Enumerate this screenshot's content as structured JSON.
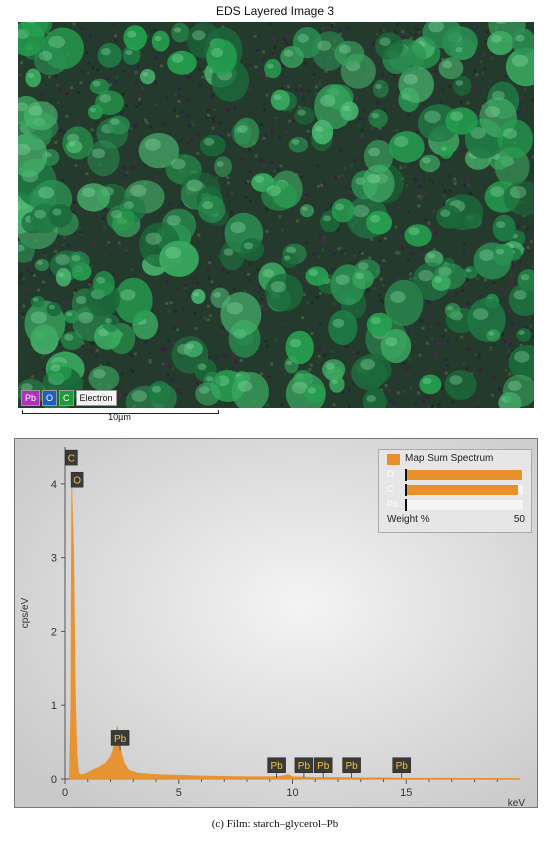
{
  "map": {
    "title": "EDS Layered Image 3",
    "channels": [
      "Pb",
      "O",
      "C",
      "Electron"
    ],
    "scale_label": "10µm"
  },
  "chart_data": {
    "type": "area",
    "xlabel": "keV",
    "ylabel": "cps/eV",
    "xlim": [
      0,
      20
    ],
    "ylim": [
      0,
      4.5
    ],
    "x_ticks": [
      0,
      5,
      10,
      15
    ],
    "y_ticks": [
      0,
      1,
      2,
      3,
      4
    ],
    "series": [
      {
        "name": "Map Sum Spectrum",
        "color": "#e8902c",
        "x": [
          0.2,
          0.26,
          0.28,
          0.3,
          0.33,
          0.38,
          0.45,
          0.52,
          0.6,
          0.7,
          0.9,
          1.2,
          1.5,
          1.8,
          2.0,
          2.1,
          2.2,
          2.3,
          2.35,
          2.4,
          2.5,
          2.6,
          2.8,
          3.2,
          4.0,
          5.0,
          6.0,
          7.0,
          8.0,
          9.0,
          9.5,
          9.8,
          10.0,
          10.5,
          11.0,
          12.0,
          13.0,
          14.0,
          15.0,
          16.0,
          17.0,
          18.0,
          19.0,
          20.0
        ],
        "y": [
          0.0,
          1.0,
          2.8,
          3.95,
          3.6,
          3.1,
          1.2,
          0.35,
          0.08,
          0.06,
          0.07,
          0.12,
          0.16,
          0.22,
          0.3,
          0.38,
          0.55,
          0.72,
          0.6,
          0.45,
          0.32,
          0.22,
          0.12,
          0.08,
          0.06,
          0.05,
          0.04,
          0.035,
          0.03,
          0.03,
          0.035,
          0.06,
          0.03,
          0.025,
          0.02,
          0.02,
          0.015,
          0.015,
          0.01,
          0.01,
          0.01,
          0.008,
          0.008,
          0.006
        ]
      }
    ],
    "peak_labels": [
      {
        "text": "C",
        "x": 0.28,
        "y": 4.35
      },
      {
        "text": "O",
        "x": 0.53,
        "y": 4.05
      },
      {
        "text": "Pb",
        "x": 2.42,
        "y": 0.55
      },
      {
        "text": "Pb",
        "x": 9.3,
        "y": 0.18
      },
      {
        "text": "Pb",
        "x": 10.5,
        "y": 0.18
      },
      {
        "text": "Pb",
        "x": 11.35,
        "y": 0.18
      },
      {
        "text": "Pb",
        "x": 12.6,
        "y": 0.18
      },
      {
        "text": "Pb",
        "x": 14.8,
        "y": 0.18
      }
    ],
    "legend_placement": "top-right",
    "legend": {
      "title": "Map Sum Spectrum",
      "elements": [
        {
          "label": "O",
          "weight_fraction": 0.99
        },
        {
          "label": "C",
          "weight_fraction": 0.96
        },
        {
          "label": "Pb",
          "weight_fraction": 0.02
        }
      ],
      "weight_label": "Weight %",
      "weight_max": "50"
    }
  },
  "caption": "(c) Film: starch–glycerol–Pb"
}
